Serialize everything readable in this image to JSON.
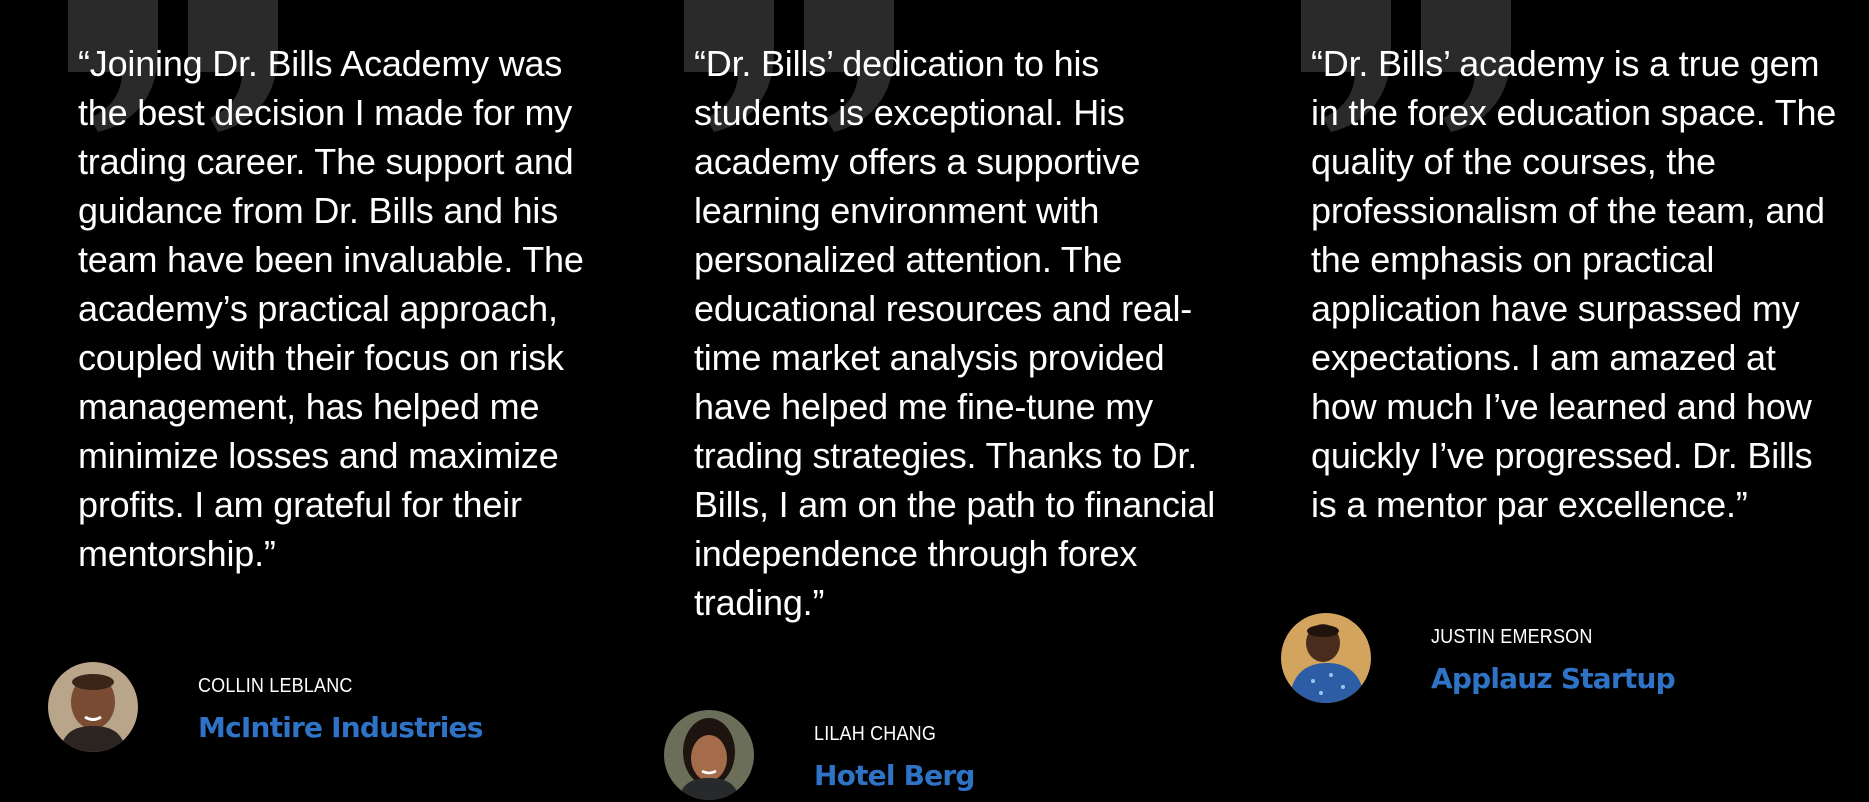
{
  "colors": {
    "background": "#000000",
    "text": "#ffffff",
    "quote_mark": "#2a2a2a",
    "company_link": "#2f73c7"
  },
  "testimonials": [
    {
      "quote": "“Joining Dr. Bills Academy was the best decision I made for my trading career. The support and guidance from Dr. Bills and his team have been invaluable. The academy’s practical approach, coupled with their focus on risk management, has helped me minimize losses and maximize profits. I am grateful for their mentorship.”",
      "name": "COLLIN LEBLANC",
      "company": "McIntire Industries",
      "avatar_icon": "person-photo-icon"
    },
    {
      "quote": "“Dr. Bills’ dedication to his students is exceptional. His academy offers a supportive learning environment with personalized attention. The educational resources and real-time market analysis provided have helped me fine-tune my trading strategies. Thanks to Dr. Bills, I am on the path to financial independence through forex trading.”",
      "name": "LILAH CHANG",
      "company": "Hotel Berg",
      "avatar_icon": "person-photo-icon"
    },
    {
      "quote": "“Dr. Bills’ academy is a true gem in the forex education space. The quality of the courses, the professionalism of the team, and the emphasis on practical application have surpassed my expectations. I am amazed at how much I’ve learned and how quickly I’ve progressed. Dr. Bills is a mentor par excellence.”",
      "name": "JUSTIN EMERSON",
      "company": "Applauz Startup",
      "avatar_icon": "person-photo-icon"
    }
  ]
}
